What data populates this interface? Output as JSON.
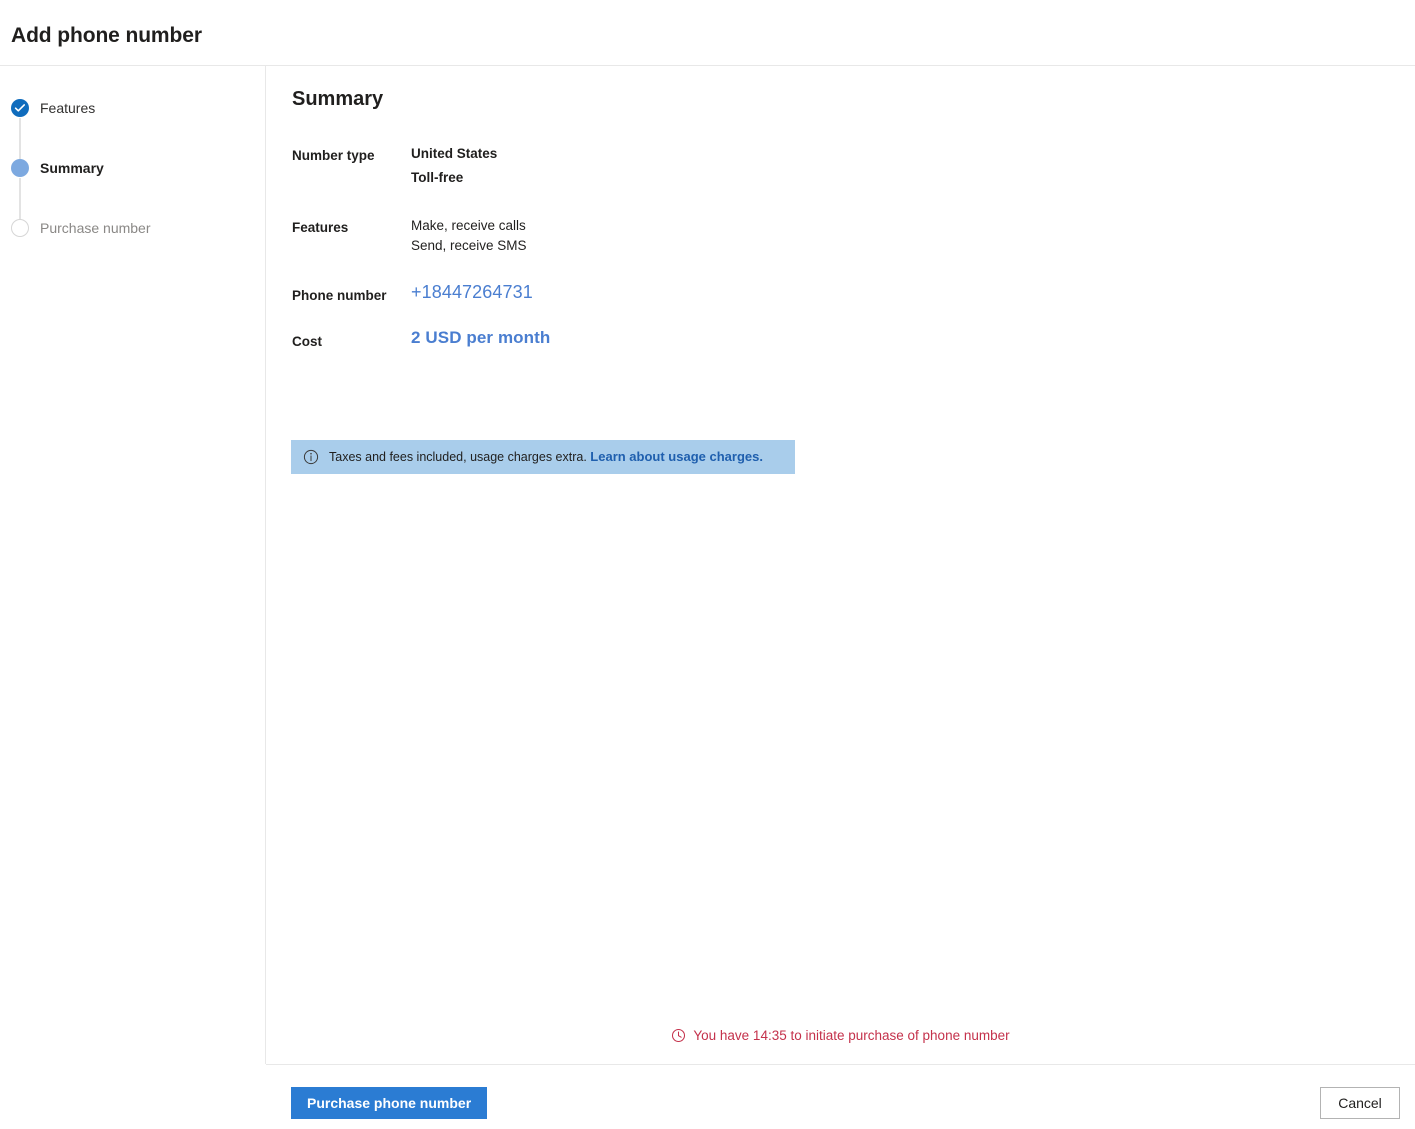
{
  "header": {
    "title": "Add phone number"
  },
  "sidebar": {
    "steps": [
      {
        "label": "Features",
        "state": "done",
        "icon": "check-icon"
      },
      {
        "label": "Summary",
        "state": "current",
        "icon": "filled-circle-icon"
      },
      {
        "label": "Purchase number",
        "state": "todo",
        "icon": "empty-circle-icon"
      }
    ]
  },
  "main": {
    "title": "Summary",
    "fields": {
      "number_type": {
        "label": "Number type",
        "values": [
          "United States",
          "Toll-free"
        ]
      },
      "features": {
        "label": "Features",
        "values": [
          "Make, receive calls",
          "Send, receive SMS"
        ]
      },
      "phone_number": {
        "label": "Phone number",
        "value": "+18447264731"
      },
      "cost": {
        "label": "Cost",
        "value": "2 USD per month"
      }
    },
    "info_banner": {
      "icon": "info-icon",
      "text": "Taxes and fees included, usage charges extra.",
      "link_text": "Learn about usage charges.",
      "background_color": "#a9cdeb",
      "link_color": "#1f5fae"
    },
    "timer": {
      "icon": "clock-icon",
      "text": "You have 14:35 to initiate purchase of phone number",
      "color": "#c4314b"
    }
  },
  "footer": {
    "primary_button": "Purchase phone number",
    "secondary_button": "Cancel",
    "primary_color": "#2b7cd3"
  }
}
